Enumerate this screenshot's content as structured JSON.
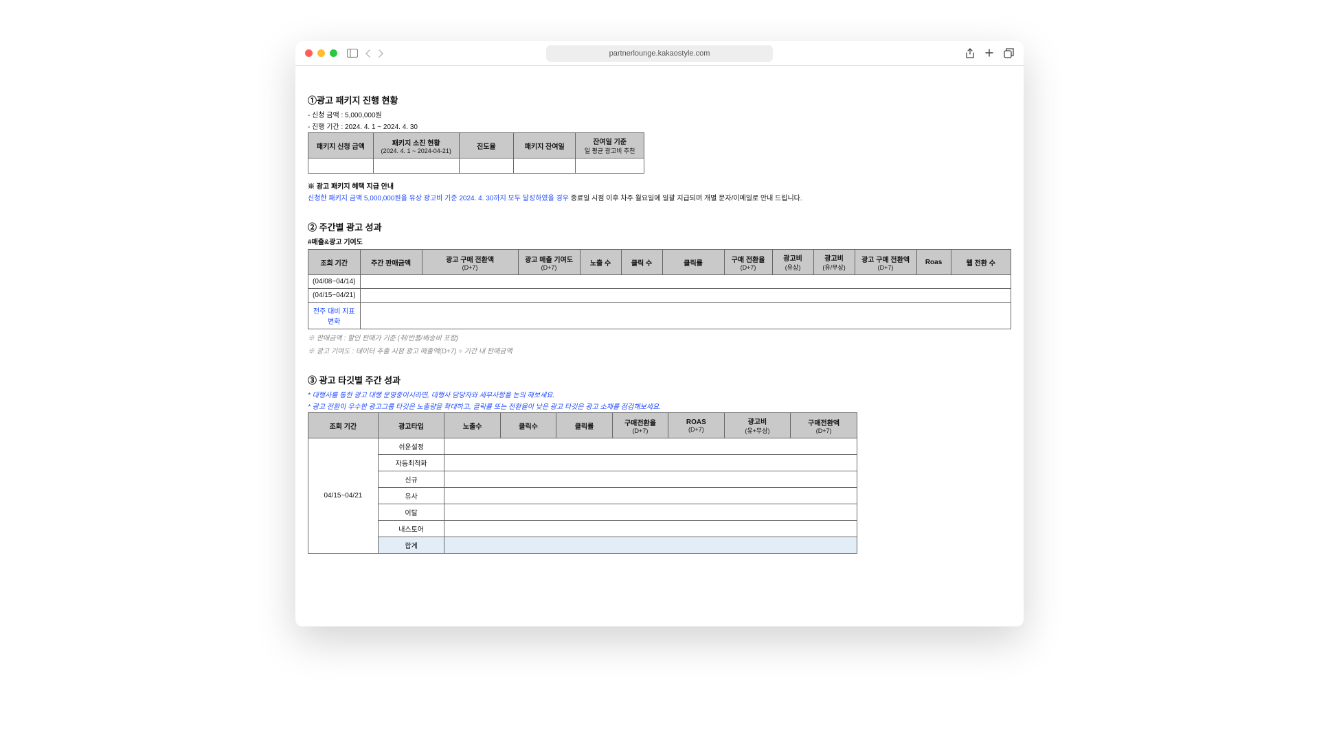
{
  "browser": {
    "url": "partnerlounge.kakaostyle.com"
  },
  "section1": {
    "title": "①광고 패키지 진행 현황",
    "line1": "- 신청 금액 : 5,000,000원",
    "line2": "- 진행 기간 : 2024. 4. 1 ~ 2024. 4. 30",
    "headers": {
      "h1": "패키지 신청 금액",
      "h2": "패키지 소진 현황",
      "h2sub": "(2024. 4. 1 ~ 2024-04-21)",
      "h3": "진도율",
      "h4": "패키지 잔여일",
      "h5": "잔여일 기준",
      "h5sub": "일 평균 광고비 추천"
    },
    "note_head": "※ 광고 패키지 혜택 지급 안내",
    "note_hl": "신청한 패키지 금액 5,000,000원을 유상 광고비 기준 2024. 4. 30까지 모두 달성하였을 경우",
    "note_rest": " 종료일 시점 이후 차주 월요일에 일괄 지급되며 개별 문자/이메일로 안내 드립니다."
  },
  "section2": {
    "title": "② 주간별 광고 성과",
    "subtitle": "#매출&광고 기여도",
    "headers": {
      "h1": "조회 기간",
      "h2": "주간 판매금액",
      "h3": "광고 구매 전환액",
      "h3sub": "(D+7)",
      "h4": "광고 매출 기여도",
      "h4sub": "(D+7)",
      "h5": "노출 수",
      "h6": "클릭 수",
      "h7": "클릭률",
      "h8": "구매 전환율",
      "h8sub": "(D+7)",
      "h9": "광고비",
      "h9sub": "(유상)",
      "h10": "광고비",
      "h10sub": "(유/무상)",
      "h11": "광고 구매 전환액",
      "h11sub": "(D+7)",
      "h12": "Roas",
      "h13": "웹 전환 수"
    },
    "rows": [
      "(04/08~04/14)",
      "(04/15~04/21)",
      "전주 대비 지표 변화"
    ],
    "foot1": "※ 판매금액 : 할인 판매가 기준 (취/반품/배송비 포함)",
    "foot2": "※ 광고 기여도 : 데이터 추출 시점 광고 매출액(D+7) ÷ 기간 내 판매금액"
  },
  "section3": {
    "title": "③ 광고 타깃별 주간 성과",
    "note1": "* 대행사를 통한 광고 대행 운영중이시라면, 대행사 담당자와 세부사항을 논의 해보세요.",
    "note2": "* 광고 전환이 우수한 광고그룹 타깃은 노출량을 확대하고, 클릭률 또는 전환율이 낮은 광고 타깃은 광고 소재를 점검해보세요.",
    "headers": {
      "h1": "조회 기간",
      "h2": "광고타입",
      "h3": "노출수",
      "h4": "클릭수",
      "h5": "클릭률",
      "h6": "구매전환율",
      "h6sub": "(D+7)",
      "h7": "ROAS",
      "h7sub": "(D+7)",
      "h8": "광고비",
      "h8sub": "(유+무상)",
      "h9": "구매전환액",
      "h9sub": "(D+7)"
    },
    "period": "04/15~04/21",
    "types": [
      "쉬운설정",
      "자동최적화",
      "신규",
      "유사",
      "이탈",
      "내스토어",
      "합계"
    ]
  }
}
